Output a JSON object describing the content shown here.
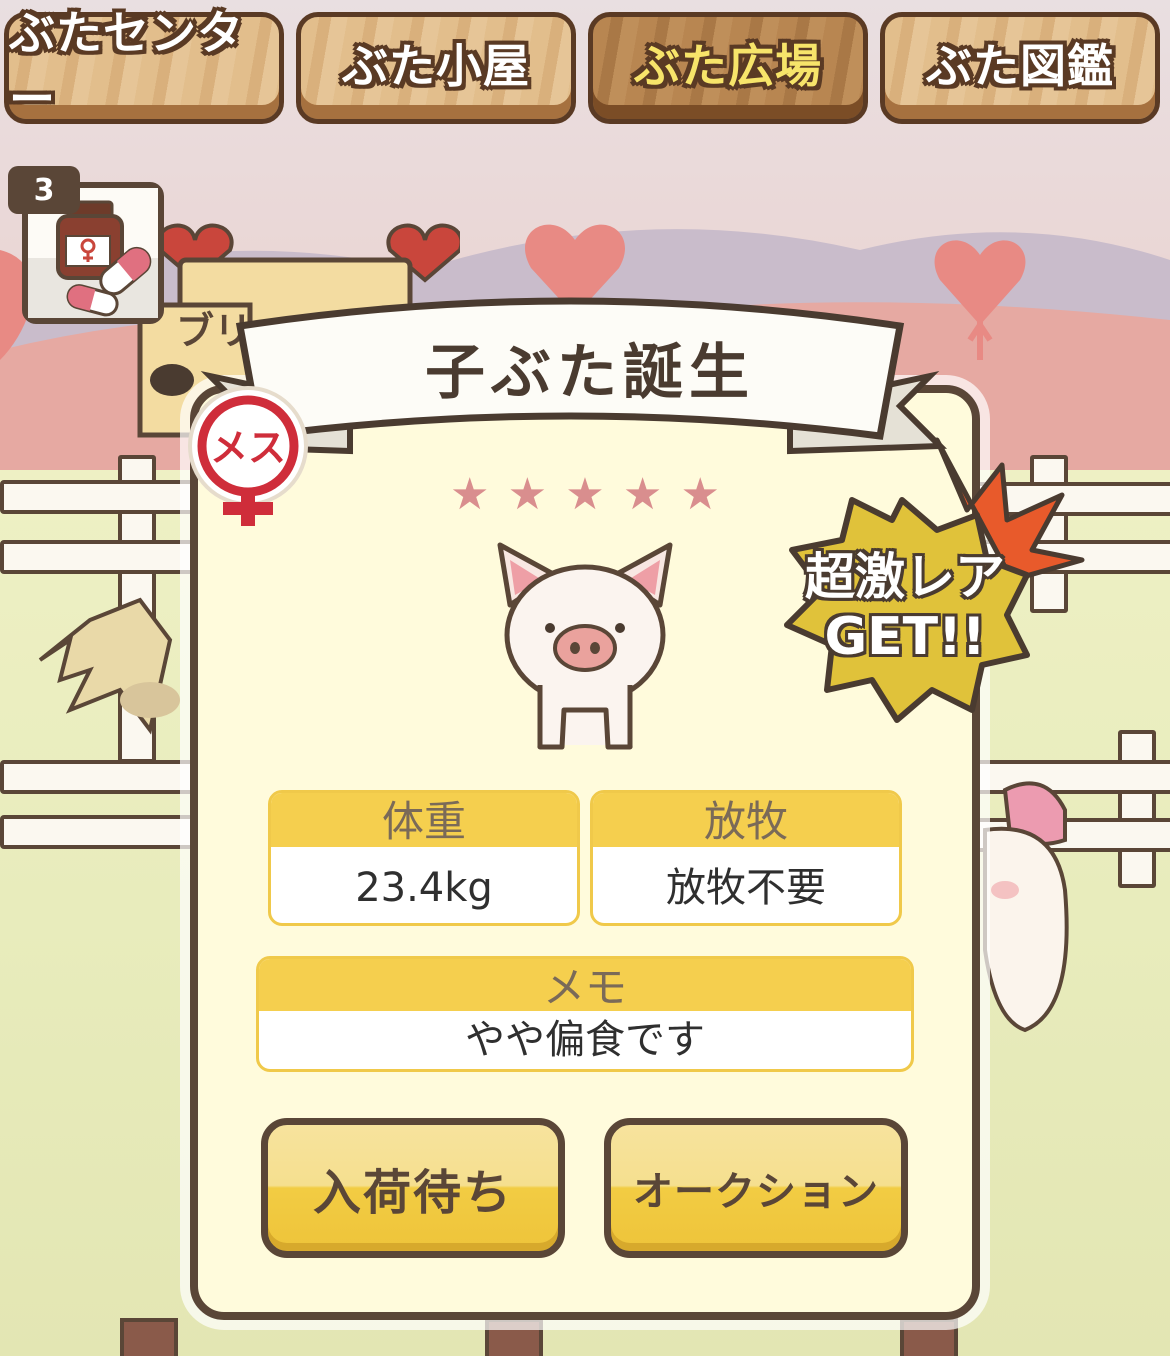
{
  "tabs": [
    {
      "label": "ぶたセンター",
      "active": false
    },
    {
      "label": "ぶた小屋",
      "active": false
    },
    {
      "label": "ぶた広場",
      "active": true
    },
    {
      "label": "ぶた図鑑",
      "active": false
    }
  ],
  "item": {
    "count": "3",
    "icon": "fertility-medicine-icon"
  },
  "sign_text": "ブリ",
  "modal": {
    "title": "子ぶた誕生",
    "gender_label": "メス",
    "gender_icon": "female-icon",
    "stars": [
      "★",
      "★",
      "★",
      "★",
      "★"
    ],
    "rare_badge": {
      "line1": "超激レア",
      "line2": "GET!!"
    },
    "weight": {
      "label": "体重",
      "value": "23.4kg"
    },
    "graze": {
      "label": "放牧",
      "value": "放牧不要"
    },
    "memo": {
      "label": "メモ",
      "value": "やや偏食です"
    },
    "buttons": {
      "wait": "入荷待ち",
      "auction": "オークション"
    }
  },
  "colors": {
    "outline": "#5a4637",
    "accent_yellow": "#f5cf4e",
    "star_pink": "#d98e8e",
    "modal_bg": "#fffbdc"
  }
}
